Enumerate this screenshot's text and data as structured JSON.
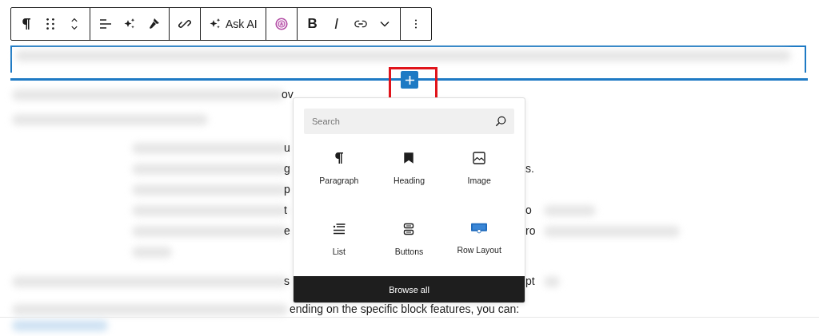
{
  "toolbar": {
    "groups": [
      {
        "items": [
          {
            "kind": "paragraph"
          },
          {
            "kind": "drag"
          },
          {
            "kind": "move"
          }
        ]
      },
      {
        "items": [
          {
            "kind": "align"
          },
          {
            "kind": "sparkle"
          },
          {
            "kind": "brush"
          }
        ]
      },
      {
        "items": [
          {
            "kind": "chain"
          }
        ]
      },
      {
        "items": [
          {
            "kind": "ask",
            "label": "Ask AI"
          }
        ]
      },
      {
        "items": [
          {
            "kind": "ailogo"
          }
        ]
      },
      {
        "items": [
          {
            "kind": "bold",
            "label": "B"
          },
          {
            "kind": "italic",
            "label": "I"
          },
          {
            "kind": "link"
          },
          {
            "kind": "chevron"
          }
        ]
      },
      {
        "items": [
          {
            "kind": "more"
          }
        ]
      }
    ]
  },
  "text_lines": [
    {
      "left": "ov"
    },
    {
      "left": "u"
    },
    {
      "left": "g",
      "right": "s."
    },
    {
      "left": "p"
    },
    {
      "left": "t",
      "right": "o"
    },
    {
      "left": "e",
      "right": "ro"
    },
    {
      "left": "s",
      "right": "pt"
    },
    {
      "left": "ending on the specific block features, you can:"
    }
  ],
  "inserter": {
    "search": {
      "placeholder": "Search"
    },
    "blocks": [
      {
        "kind": "paragraph",
        "label": "Paragraph"
      },
      {
        "kind": "heading",
        "label": "Heading"
      },
      {
        "kind": "image",
        "label": "Image"
      },
      {
        "kind": "list",
        "label": "List"
      },
      {
        "kind": "buttons",
        "label": "Buttons"
      },
      {
        "kind": "row",
        "label": "Row Layout"
      }
    ],
    "browse": "Browse all"
  }
}
